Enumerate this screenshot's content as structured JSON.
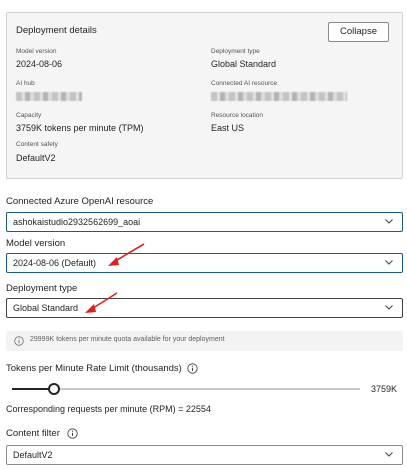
{
  "details": {
    "title": "Deployment details",
    "collapse_label": "Collapse",
    "model_version_label": "Model version",
    "model_version_value": "2024-08-06",
    "deployment_type_label": "Deployment type",
    "deployment_type_value": "Global Standard",
    "ai_hub_label": "AI hub",
    "connected_ai_label": "Connected AI resource",
    "capacity_label": "Capacity",
    "capacity_value": "3759K tokens per minute (TPM)",
    "resource_location_label": "Resource location",
    "resource_location_value": "East US",
    "content_safety_label": "Content safety",
    "content_safety_value": "DefaultV2"
  },
  "connected_resource": {
    "label": "Connected Azure OpenAI resource",
    "value": "ashokaistudio2932562699_aoai"
  },
  "model_version": {
    "label": "Model version",
    "value": "2024-08-06 (Default)"
  },
  "deployment_type": {
    "label": "Deployment type",
    "value": "Global Standard"
  },
  "quota_info": "29999K tokens per minute quota available for your deployment",
  "rate_limit": {
    "label": "Tokens per Minute Rate Limit (thousands)",
    "max_label": "3759K",
    "fraction": 0.12,
    "rpm_text": "Corresponding requests per minute (RPM) = 22554"
  },
  "content_filter": {
    "label": "Content filter",
    "value": "DefaultV2"
  },
  "colors": {
    "focus_border": "#1c5a86",
    "arrow": "#e02020",
    "panel_bg": "#f5f5f5"
  },
  "icons": [
    "chevron-down-icon",
    "info-icon"
  ]
}
